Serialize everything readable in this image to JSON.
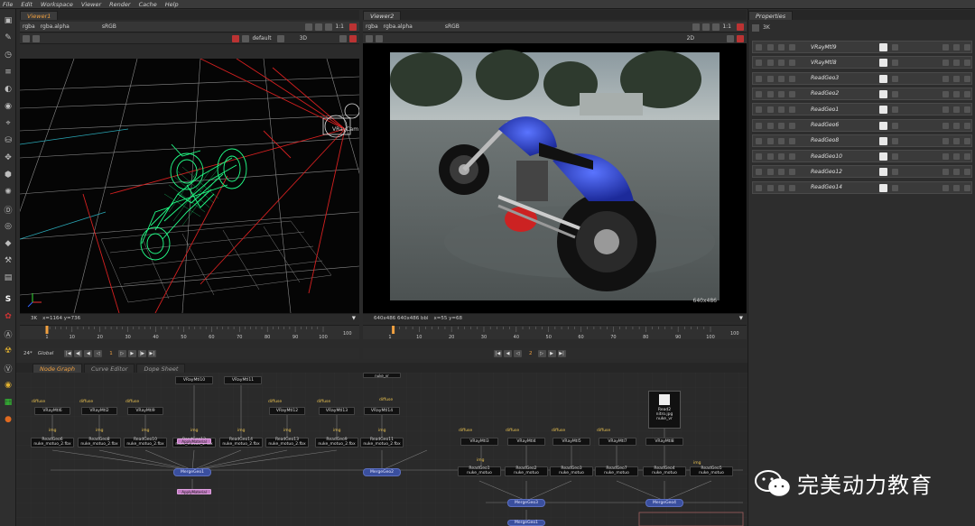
{
  "menu": [
    "File",
    "Edit",
    "Workspace",
    "Viewer",
    "Render",
    "Cache",
    "Help"
  ],
  "viewer1": {
    "tab": "Viewer1",
    "channels": "rgba",
    "alpha": "rgba.alpha",
    "colorspace": "sRGB",
    "zoom": "1:1",
    "camera": "default",
    "mode": "3D",
    "status_format": "3K",
    "status_coords": "x=1164 y=736",
    "camera_label": "VRayCam"
  },
  "viewer2": {
    "tab": "Viewer2",
    "channels": "rgba",
    "alpha": "rgba.alpha",
    "colorspace": "sRGB",
    "zoom": "1:1",
    "mode": "2D",
    "status_format": "640x486 640x486 bbl",
    "status_coords": "x=55 y=68",
    "corner_label": "640x486"
  },
  "timeline1": {
    "fps": "24*",
    "scope": "Global",
    "ticks": [
      "1",
      "10",
      "20",
      "30",
      "40",
      "50",
      "60",
      "70",
      "80",
      "90",
      "100"
    ],
    "end": "100",
    "frame": "1"
  },
  "timeline2": {
    "ticks": [
      "1",
      "10",
      "20",
      "30",
      "40",
      "50",
      "60",
      "70",
      "80",
      "90",
      "100"
    ],
    "end": "100",
    "frame": "2"
  },
  "properties": {
    "tab": "Properties",
    "filter": "3K",
    "rows": [
      "VRayMtl9",
      "VRayMtl8",
      "ReadGeo3",
      "ReadGeo2",
      "ReadGeo1",
      "ReadGeo6",
      "ReadGeo8",
      "ReadGeo10",
      "ReadGeo12",
      "ReadGeo14"
    ]
  },
  "nodegraph_tabs": [
    "Node Graph",
    "Curve Editor",
    "Dope Sheet"
  ],
  "nodes": {
    "vray_top": [
      "VRayMtl10",
      "VRayMtl11"
    ],
    "vray_row": [
      "VRayMtl6",
      "VRayMtl2",
      "VRayMtl9",
      "VRayMtl12",
      "VRayMtl13",
      "VRayMtl14"
    ],
    "readgeo_row": [
      {
        "name": "ReadGeo6",
        "file": "nuke_motuo_2.fbx"
      },
      {
        "name": "ReadGeo8",
        "file": "nuke_motuo_2.fbx"
      },
      {
        "name": "ReadGeo10",
        "file": "nuke_motuo_2.fbx"
      },
      {
        "name": "ReadGeo12",
        "file": "nuke_motuo_2.fbx"
      },
      {
        "name": "ReadGeo14",
        "file": "nuke_motuo_2.fbx"
      },
      {
        "name": "ReadGeo13",
        "file": "nuke_motuo_2.fbx"
      },
      {
        "name": "ReadGeo9",
        "file": "nuke_motuo_2.fbx"
      },
      {
        "name": "ReadGeo11",
        "file": "nuke_motuo_2.fbx"
      }
    ],
    "vray_right": [
      "VRayMtl3",
      "VRayMtl4",
      "VRayMtl5",
      "VRayMtl7",
      "VRayMtl8"
    ],
    "read2": {
      "name": "Read2",
      "file": "nitro.jpg",
      "sub": "nuke_vr"
    },
    "readgeo_right": [
      {
        "name": "ReadGeo1",
        "file": "nuke_motuo"
      },
      {
        "name": "ReadGeo2",
        "file": "nuke_motuo"
      },
      {
        "name": "ReadGeo3",
        "file": "nuke_motuo"
      },
      {
        "name": "ReadGeo7",
        "file": "nuke_motuo"
      },
      {
        "name": "ReadGeo4",
        "file": "nuke_motuo"
      },
      {
        "name": "ReadGeo5",
        "file": "nuke_motuo"
      }
    ],
    "merge": [
      "MergeGeo1",
      "MergeGeo2",
      "MergeGeo3",
      "MergeGeo4"
    ],
    "input_diffuse": "diffuse",
    "input_img": "img",
    "input_scene": "nuke_vr",
    "pink_node": "ApplyMaterial"
  },
  "watermark": "完美动力教育",
  "colors": {
    "accent": "#f0a040",
    "wire_green": "#22ff88",
    "merge_blue": "#3a4f9e"
  }
}
